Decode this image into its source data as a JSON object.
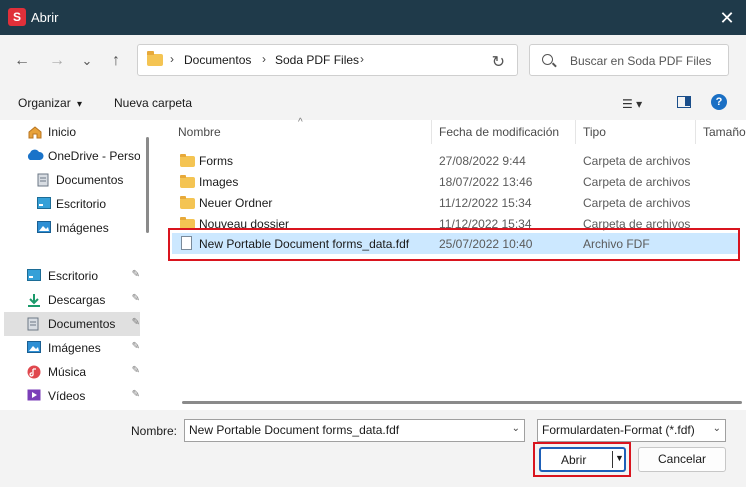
{
  "window": {
    "title": "Abrir",
    "app_icon_letter": "S",
    "app_icon_color": "#e0303a",
    "titlebar_color": "#1f3a4a"
  },
  "nav": {
    "back_icon": "←",
    "forward_icon": "→",
    "history_icon": "⌄",
    "up_icon": "↑",
    "refresh_icon": "↻",
    "chevron": "›"
  },
  "address": {
    "segments": [
      "Documentos",
      "Soda PDF Files"
    ]
  },
  "search": {
    "placeholder": "Buscar en Soda PDF Files"
  },
  "toolbar": {
    "organize_label": "Organizar",
    "organize_arrow": "▾",
    "new_folder_label": "Nueva carpeta",
    "view_icon": "☰ ▾",
    "help_label": "?"
  },
  "sidebar": {
    "items": [
      {
        "label": "Inicio",
        "icon": "home-icon"
      },
      {
        "label": "OneDrive - Perso",
        "icon": "cloud-icon"
      },
      {
        "label": "Documentos",
        "icon": "documents-icon"
      },
      {
        "label": "Escritorio",
        "icon": "desktop-icon"
      },
      {
        "label": "Imágenes",
        "icon": "pictures-icon"
      },
      {
        "label": "Escritorio",
        "icon": "desktop-icon",
        "pinned": true
      },
      {
        "label": "Descargas",
        "icon": "downloads-icon",
        "pinned": true
      },
      {
        "label": "Documentos",
        "icon": "documents-icon",
        "pinned": true,
        "active": true
      },
      {
        "label": "Imágenes",
        "icon": "pictures-icon",
        "pinned": true
      },
      {
        "label": "Música",
        "icon": "music-icon",
        "pinned": true
      },
      {
        "label": "Vídeos",
        "icon": "videos-icon",
        "pinned": true
      }
    ],
    "pin_glyph": "📌"
  },
  "columns": {
    "name": "Nombre",
    "modified": "Fecha de modificación",
    "type": "Tipo",
    "size": "Tamaño",
    "sort_glyph": "^"
  },
  "files": [
    {
      "name": "Forms",
      "modified": "27/08/2022 9:44",
      "type": "Carpeta de archivos",
      "kind": "folder"
    },
    {
      "name": "Images",
      "modified": "18/07/2022 13:46",
      "type": "Carpeta de archivos",
      "kind": "folder"
    },
    {
      "name": "Neuer Ordner",
      "modified": "11/12/2022 15:34",
      "type": "Carpeta de archivos",
      "kind": "folder"
    },
    {
      "name": "Nouveau dossier",
      "modified": "11/12/2022 15:34",
      "type": "Carpeta de archivos",
      "kind": "folder"
    },
    {
      "name": "New Portable Document forms_data.fdf",
      "modified": "25/07/2022 10:40",
      "type": "Archivo FDF",
      "kind": "file",
      "selected": true
    }
  ],
  "footer": {
    "name_label": "Nombre:",
    "name_value": "New Portable Document forms_data.fdf",
    "type_value": "Formulardaten-Format (*.fdf)",
    "dropdown_glyph": "⌄",
    "open_label": "Abrir",
    "open_arrow": "▼",
    "cancel_label": "Cancelar"
  },
  "colors": {
    "highlight_box": "#d9141e",
    "selection": "#cce8ff",
    "accent": "#1d5fb8"
  }
}
